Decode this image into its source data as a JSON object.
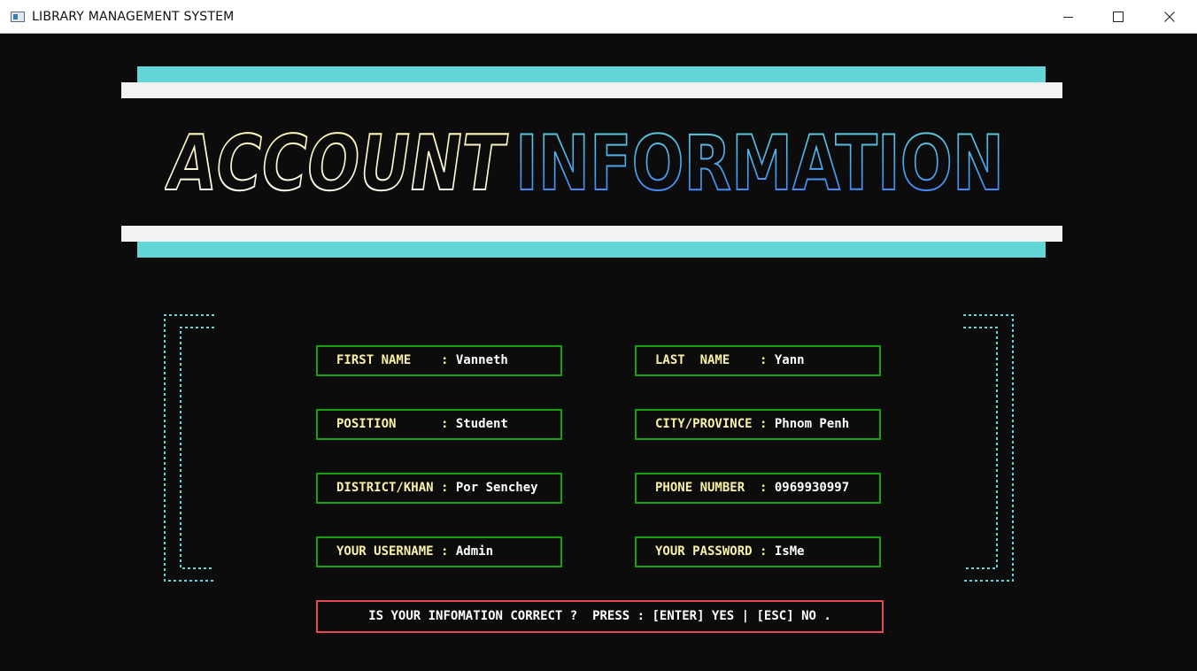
{
  "window": {
    "title": "LIBRARY MANAGEMENT SYSTEM",
    "minimize_label": "—",
    "maximize_label": "☐",
    "close_label": "✕"
  },
  "banner": {
    "word1": "ACCOUNT",
    "word2": "INFORMATION",
    "colors": {
      "word1_top": "#f9f1a5",
      "word1_bottom": "#ffffff",
      "word2_top": "#61d6d6",
      "word2_bottom": "#3b78ff"
    }
  },
  "fields": [
    {
      "label": "FIRST NAME    : ",
      "value": "Vanneth"
    },
    {
      "label": "LAST  NAME    : ",
      "value": "Yann"
    },
    {
      "label": "POSITION      : ",
      "value": "Student"
    },
    {
      "label": "CITY/PROVINCE : ",
      "value": "Phnom Penh"
    },
    {
      "label": "DISTRICT/KHAN : ",
      "value": "Por Senchey"
    },
    {
      "label": "PHONE NUMBER  : ",
      "value": "0969930997"
    },
    {
      "label": "YOUR USERNAME : ",
      "value": "Admin"
    },
    {
      "label": "YOUR PASSWORD : ",
      "value": "IsMe"
    }
  ],
  "confirm": {
    "text": "IS YOUR INFOMATION CORRECT ?  PRESS : [ENTER] YES | [ESC] NO ."
  },
  "colors": {
    "background": "#0c0c0c",
    "accent_cyan": "#61d6d6",
    "accent_white": "#f2f2f2",
    "field_border": "#13a10e",
    "confirm_border": "#e74856",
    "label_yellow": "#f9f1a5"
  }
}
